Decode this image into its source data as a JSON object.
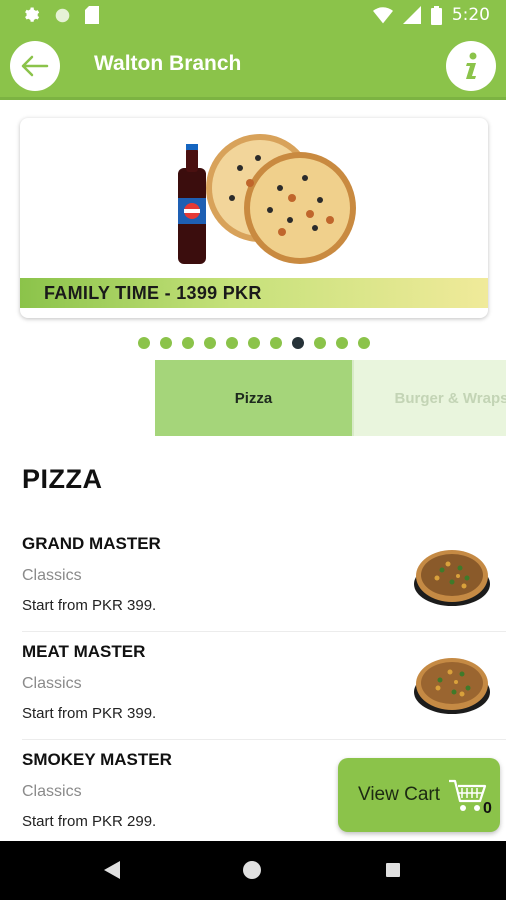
{
  "status_bar": {
    "time": "5:20",
    "icons": [
      "settings-icon",
      "circle-icon",
      "sd-card-icon",
      "wifi-icon",
      "signal-icon",
      "battery-icon"
    ]
  },
  "app_bar": {
    "title": "Walton Branch",
    "back_icon": "arrow-left-icon",
    "info_icon": "info-icon",
    "color": "#8bc34a"
  },
  "banner": {
    "caption": "FAMILY TIME - 1399 PKR"
  },
  "carousel": {
    "total_dots": 11,
    "active_index": 7
  },
  "tabs": [
    {
      "label": "Pizza",
      "selected": true
    },
    {
      "label": "Burger & Wraps",
      "selected": false
    }
  ],
  "section": {
    "title": "PIZZA"
  },
  "items": [
    {
      "name": "GRAND MASTER",
      "category": "Classics",
      "price": "Start from PKR 399."
    },
    {
      "name": "MEAT MASTER",
      "category": "Classics",
      "price": "Start from PKR 399."
    },
    {
      "name": "SMOKEY MASTER",
      "category": "Classics",
      "price": "Start from PKR 299."
    }
  ],
  "cart": {
    "label": "View Cart",
    "count": "0",
    "icon": "cart-icon"
  },
  "nav_bar": {
    "icons": [
      "nav-back-icon",
      "nav-home-icon",
      "nav-recent-icon"
    ]
  }
}
